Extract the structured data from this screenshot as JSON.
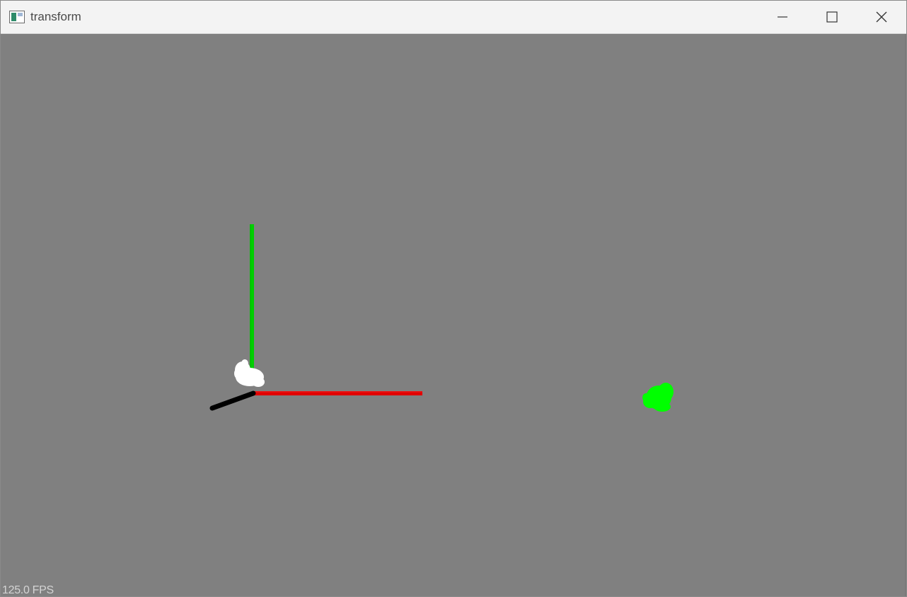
{
  "window": {
    "title": "transform",
    "icon": "app-window-icon",
    "controls": {
      "minimize_icon": "minimize-icon",
      "maximize_icon": "maximize-icon",
      "close_icon": "close-icon"
    }
  },
  "viewport": {
    "background": "#808080",
    "fps_label": "125.0 FPS",
    "axes": {
      "x_axis_color": "#e00000",
      "y_axis_color": "#00d000",
      "z_axis_color": "#000000"
    },
    "objects": {
      "origin_model_color": "#ffffff",
      "transformed_model_color": "#00ff00"
    }
  }
}
